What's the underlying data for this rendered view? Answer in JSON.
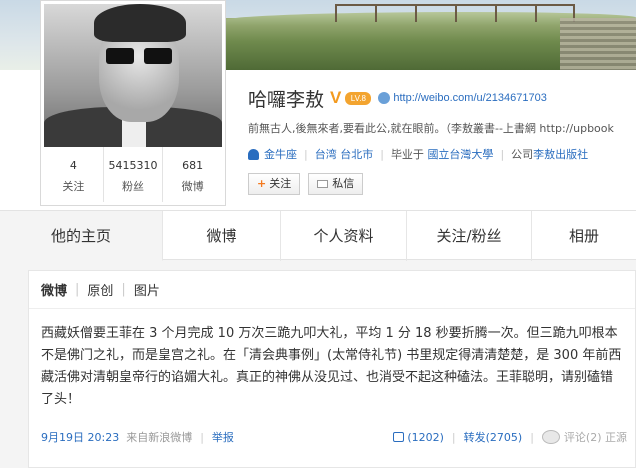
{
  "profile": {
    "name": "哈囉李敖",
    "verified_mark": "V",
    "level": "LV.8",
    "url": "http://weibo.com/u/2134671703",
    "bio": "前無古人,後無來者,要看此公,就在眼前。（李敖叢書--上書網 http://upbook",
    "zodiac": "金牛座",
    "location": "台湾 台北市",
    "school_prefix": "毕业于",
    "school": "國立台灣大學",
    "company_prefix": "公司",
    "company": "李敖出版社",
    "follow_label": "关注",
    "message_label": "私信",
    "stats": [
      {
        "num": "4",
        "label": "关注"
      },
      {
        "num": "5415310",
        "label": "粉丝"
      },
      {
        "num": "681",
        "label": "微博"
      }
    ]
  },
  "tabs": [
    {
      "label": "他的主页"
    },
    {
      "label": "微博"
    },
    {
      "label": "个人资料"
    },
    {
      "label": "关注/粉丝"
    },
    {
      "label": "相册"
    }
  ],
  "feed": {
    "subtabs": [
      "微博",
      "原创",
      "图片"
    ],
    "post": {
      "text": "西藏妖僧要王菲在 3 个月完成 10 万次三跪九叩大礼，平均 1 分 18 秒要折腾一次。但三跪九叩根本不是佛门之礼，而是皇宫之礼。在「清会典事例」(太常侍礼节) 书里规定得清清楚楚，是 300 年前西藏活佛对清朝皇帝行的谄媚大礼。真正的神佛从没见过、也消受不起这种磕法。王菲聪明，请别磕错了头！",
      "time": "9月19日 20:23",
      "source": "来自新浪微博",
      "report": "举报",
      "likes": "(1202)",
      "repost": "转发(2705)",
      "comments": "评论(2)",
      "watermark": "正源"
    }
  }
}
